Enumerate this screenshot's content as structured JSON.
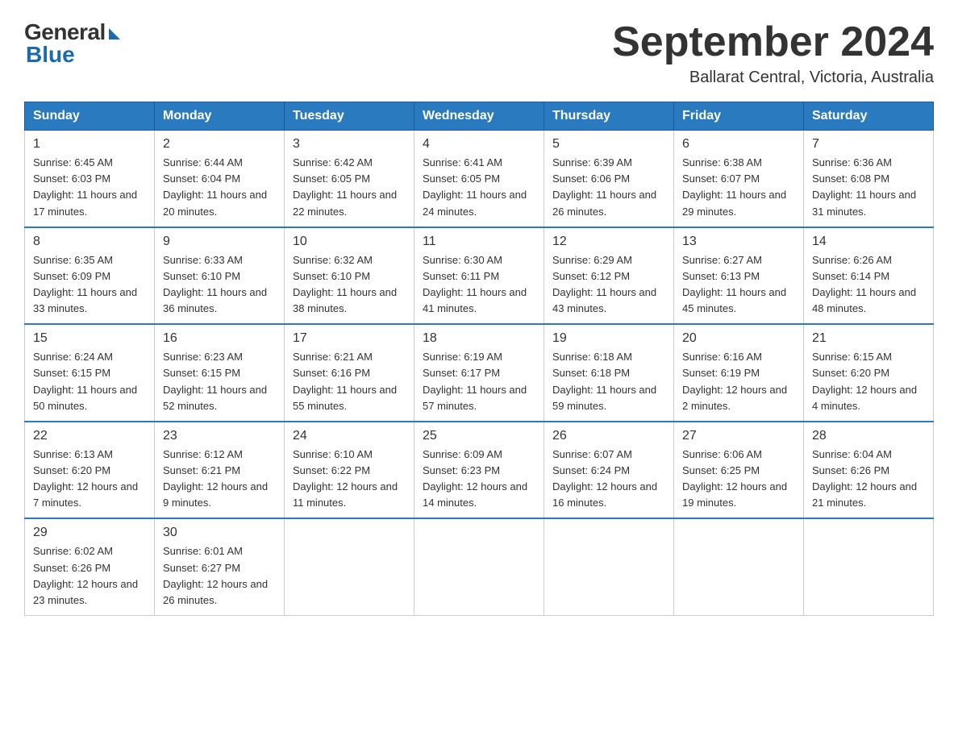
{
  "header": {
    "logo_general": "General",
    "logo_blue": "Blue",
    "month_title": "September 2024",
    "location": "Ballarat Central, Victoria, Australia"
  },
  "weekdays": [
    "Sunday",
    "Monday",
    "Tuesday",
    "Wednesday",
    "Thursday",
    "Friday",
    "Saturday"
  ],
  "weeks": [
    [
      {
        "day": "1",
        "sunrise": "6:45 AM",
        "sunset": "6:03 PM",
        "daylight": "11 hours and 17 minutes."
      },
      {
        "day": "2",
        "sunrise": "6:44 AM",
        "sunset": "6:04 PM",
        "daylight": "11 hours and 20 minutes."
      },
      {
        "day": "3",
        "sunrise": "6:42 AM",
        "sunset": "6:05 PM",
        "daylight": "11 hours and 22 minutes."
      },
      {
        "day": "4",
        "sunrise": "6:41 AM",
        "sunset": "6:05 PM",
        "daylight": "11 hours and 24 minutes."
      },
      {
        "day": "5",
        "sunrise": "6:39 AM",
        "sunset": "6:06 PM",
        "daylight": "11 hours and 26 minutes."
      },
      {
        "day": "6",
        "sunrise": "6:38 AM",
        "sunset": "6:07 PM",
        "daylight": "11 hours and 29 minutes."
      },
      {
        "day": "7",
        "sunrise": "6:36 AM",
        "sunset": "6:08 PM",
        "daylight": "11 hours and 31 minutes."
      }
    ],
    [
      {
        "day": "8",
        "sunrise": "6:35 AM",
        "sunset": "6:09 PM",
        "daylight": "11 hours and 33 minutes."
      },
      {
        "day": "9",
        "sunrise": "6:33 AM",
        "sunset": "6:10 PM",
        "daylight": "11 hours and 36 minutes."
      },
      {
        "day": "10",
        "sunrise": "6:32 AM",
        "sunset": "6:10 PM",
        "daylight": "11 hours and 38 minutes."
      },
      {
        "day": "11",
        "sunrise": "6:30 AM",
        "sunset": "6:11 PM",
        "daylight": "11 hours and 41 minutes."
      },
      {
        "day": "12",
        "sunrise": "6:29 AM",
        "sunset": "6:12 PM",
        "daylight": "11 hours and 43 minutes."
      },
      {
        "day": "13",
        "sunrise": "6:27 AM",
        "sunset": "6:13 PM",
        "daylight": "11 hours and 45 minutes."
      },
      {
        "day": "14",
        "sunrise": "6:26 AM",
        "sunset": "6:14 PM",
        "daylight": "11 hours and 48 minutes."
      }
    ],
    [
      {
        "day": "15",
        "sunrise": "6:24 AM",
        "sunset": "6:15 PM",
        "daylight": "11 hours and 50 minutes."
      },
      {
        "day": "16",
        "sunrise": "6:23 AM",
        "sunset": "6:15 PM",
        "daylight": "11 hours and 52 minutes."
      },
      {
        "day": "17",
        "sunrise": "6:21 AM",
        "sunset": "6:16 PM",
        "daylight": "11 hours and 55 minutes."
      },
      {
        "day": "18",
        "sunrise": "6:19 AM",
        "sunset": "6:17 PM",
        "daylight": "11 hours and 57 minutes."
      },
      {
        "day": "19",
        "sunrise": "6:18 AM",
        "sunset": "6:18 PM",
        "daylight": "11 hours and 59 minutes."
      },
      {
        "day": "20",
        "sunrise": "6:16 AM",
        "sunset": "6:19 PM",
        "daylight": "12 hours and 2 minutes."
      },
      {
        "day": "21",
        "sunrise": "6:15 AM",
        "sunset": "6:20 PM",
        "daylight": "12 hours and 4 minutes."
      }
    ],
    [
      {
        "day": "22",
        "sunrise": "6:13 AM",
        "sunset": "6:20 PM",
        "daylight": "12 hours and 7 minutes."
      },
      {
        "day": "23",
        "sunrise": "6:12 AM",
        "sunset": "6:21 PM",
        "daylight": "12 hours and 9 minutes."
      },
      {
        "day": "24",
        "sunrise": "6:10 AM",
        "sunset": "6:22 PM",
        "daylight": "12 hours and 11 minutes."
      },
      {
        "day": "25",
        "sunrise": "6:09 AM",
        "sunset": "6:23 PM",
        "daylight": "12 hours and 14 minutes."
      },
      {
        "day": "26",
        "sunrise": "6:07 AM",
        "sunset": "6:24 PM",
        "daylight": "12 hours and 16 minutes."
      },
      {
        "day": "27",
        "sunrise": "6:06 AM",
        "sunset": "6:25 PM",
        "daylight": "12 hours and 19 minutes."
      },
      {
        "day": "28",
        "sunrise": "6:04 AM",
        "sunset": "6:26 PM",
        "daylight": "12 hours and 21 minutes."
      }
    ],
    [
      {
        "day": "29",
        "sunrise": "6:02 AM",
        "sunset": "6:26 PM",
        "daylight": "12 hours and 23 minutes."
      },
      {
        "day": "30",
        "sunrise": "6:01 AM",
        "sunset": "6:27 PM",
        "daylight": "12 hours and 26 minutes."
      },
      null,
      null,
      null,
      null,
      null
    ]
  ],
  "labels": {
    "sunrise": "Sunrise:",
    "sunset": "Sunset:",
    "daylight": "Daylight:"
  }
}
